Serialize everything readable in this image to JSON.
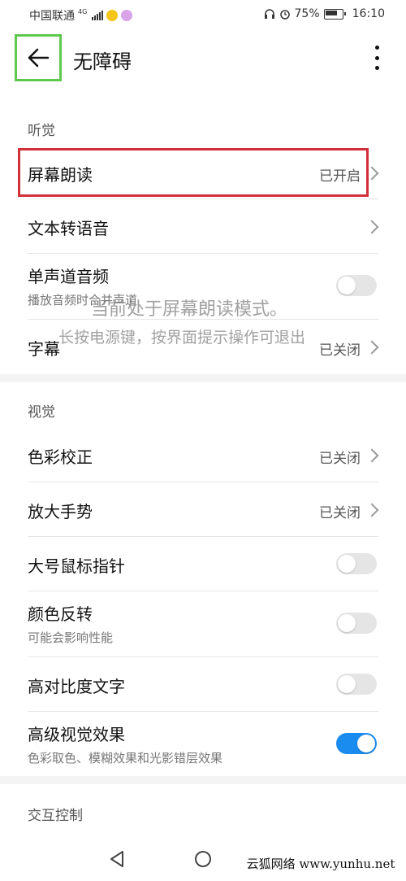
{
  "status_bar": {
    "carrier": "中国联通",
    "network": "4G",
    "alarm_icon": "alarm-icon",
    "battery": "75%",
    "time": "16:10"
  },
  "header": {
    "title": "无障碍",
    "back_icon": "arrow-left-icon",
    "more_icon": "more-vertical-icon"
  },
  "sections": {
    "hearing": {
      "title": "听觉",
      "items": [
        {
          "label": "屏幕朗读",
          "value": "已开启"
        },
        {
          "label": "文本转语音"
        },
        {
          "label": "单声道音频",
          "sub": "播放音频时合并声道",
          "toggle": false
        },
        {
          "label": "字幕",
          "value": "已关闭"
        }
      ]
    },
    "vision": {
      "title": "视觉",
      "items": [
        {
          "label": "色彩校正",
          "value": "已关闭"
        },
        {
          "label": "放大手势",
          "value": "已关闭"
        },
        {
          "label": "大号鼠标指针",
          "toggle": false
        },
        {
          "label": "颜色反转",
          "sub": "可能会影响性能",
          "toggle": false
        },
        {
          "label": "高对比度文字",
          "toggle": false
        },
        {
          "label": "高级视觉效果",
          "sub": "色彩取色、模糊效果和光影错层效果",
          "toggle": true
        }
      ]
    },
    "interaction": {
      "title": "交互控制"
    }
  },
  "overlay": {
    "line1": "当前处于屏幕朗读模式。",
    "line2": "长按电源键，按界面提示操作可退出"
  },
  "nav": {
    "back": "triangle-back-icon",
    "home": "circle-home-icon",
    "recent": "square-recent-icon"
  },
  "watermark": "云狐网络 www.yunhu.net",
  "colors": {
    "accent": "#1a8cf0",
    "highlight_red": "#d32f3a",
    "highlight_green": "#5ec84e"
  }
}
